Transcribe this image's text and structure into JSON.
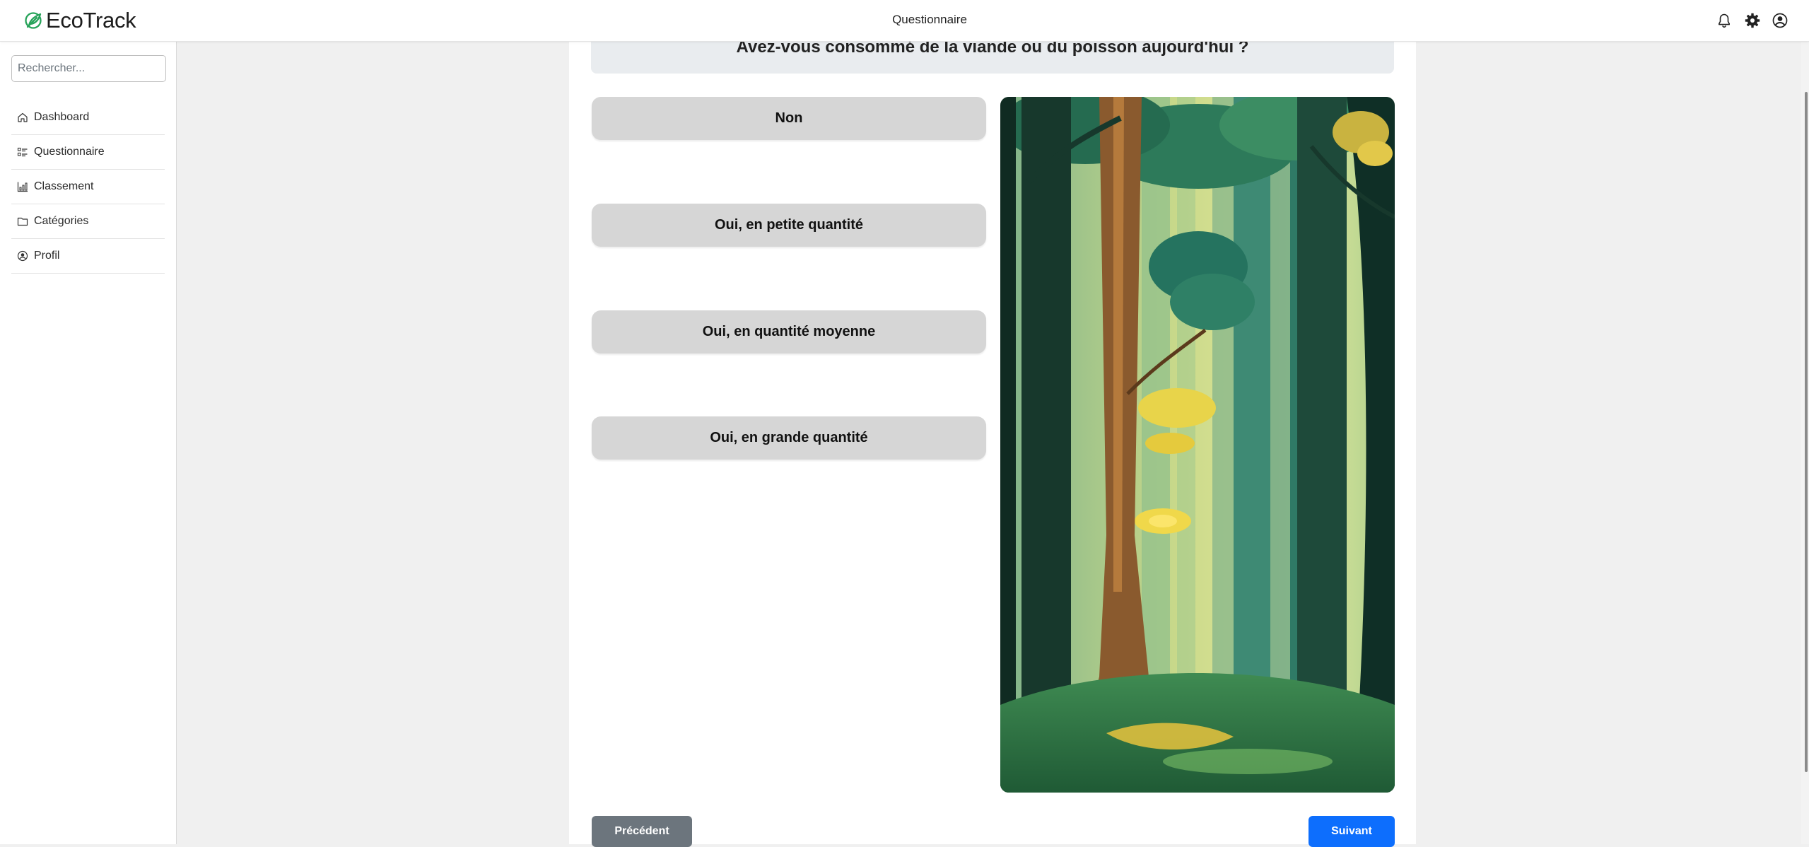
{
  "app": {
    "name": "EcoTrack",
    "page_title": "Questionnaire",
    "accent_color": "#0d6efd",
    "brand_color": "#27a35a"
  },
  "header": {
    "icons": [
      "bell-icon",
      "gear-icon",
      "user-circle-icon"
    ]
  },
  "sidebar": {
    "search_placeholder": "Rechercher...",
    "items": [
      {
        "label": "Dashboard",
        "icon": "home-icon"
      },
      {
        "label": "Questionnaire",
        "icon": "list-check-icon"
      },
      {
        "label": "Classement",
        "icon": "bar-chart-icon"
      },
      {
        "label": "Catégories",
        "icon": "folder-icon"
      },
      {
        "label": "Profil",
        "icon": "user-circle-icon"
      }
    ]
  },
  "main": {
    "question": "Avez-vous consommé de la viande ou du poisson aujourd'hui ?",
    "answers": [
      "Non",
      "Oui, en petite quantité",
      "Oui, en quantité moyenne",
      "Oui, en grande quantité"
    ],
    "illustration": "forest-illustration",
    "prev_label": "Précédent",
    "next_label": "Suivant"
  }
}
